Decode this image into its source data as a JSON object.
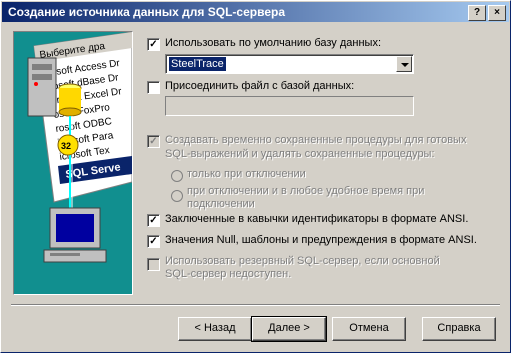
{
  "window": {
    "title": "Создание источника данных для SQL-сервера",
    "help_btn": "?",
    "close_btn": "×"
  },
  "illustration": {
    "header": "Выберите дра",
    "items": [
      "rosoft Access Dr",
      "rosoft dBase Dr",
      "crosoft Excel Dr",
      "osoft FoxPro",
      "rosoft ODBC",
      "icrosoft Para",
      "icrosoft Tex",
      "SQL Serve"
    ]
  },
  "options": {
    "default_db": {
      "label": "Использовать по умолчанию базу данных:",
      "checked": true
    },
    "db_value": "SteelTrace",
    "attach_file": {
      "label": "Присоединить файл с базой данных:",
      "checked": false
    },
    "temp_procs": {
      "label_1": "Создавать временно сохраненные процедуры для готовых",
      "label_2": "SQL-выражений и удалять сохраненные процедуры:"
    },
    "radio_only_disconnect": "только при отключении",
    "radio_any_1": "при отключении и в любое удобное время при",
    "radio_any_2": "подключении",
    "quoted_ids": {
      "label": "Заключенные в кавычки идентификаторы в формате ANSI.",
      "checked": true
    },
    "ansi_nulls": {
      "label": "Значения Null, шаблоны и предупреждения в формате ANSI.",
      "checked": true
    },
    "failover_1": "Использовать резервный SQL-сервер, если основной",
    "failover_2": "SQL-сервер недоступен."
  },
  "buttons": {
    "back": "< Назад",
    "next": "Далее >",
    "cancel": "Отмена",
    "help": "Справка"
  }
}
